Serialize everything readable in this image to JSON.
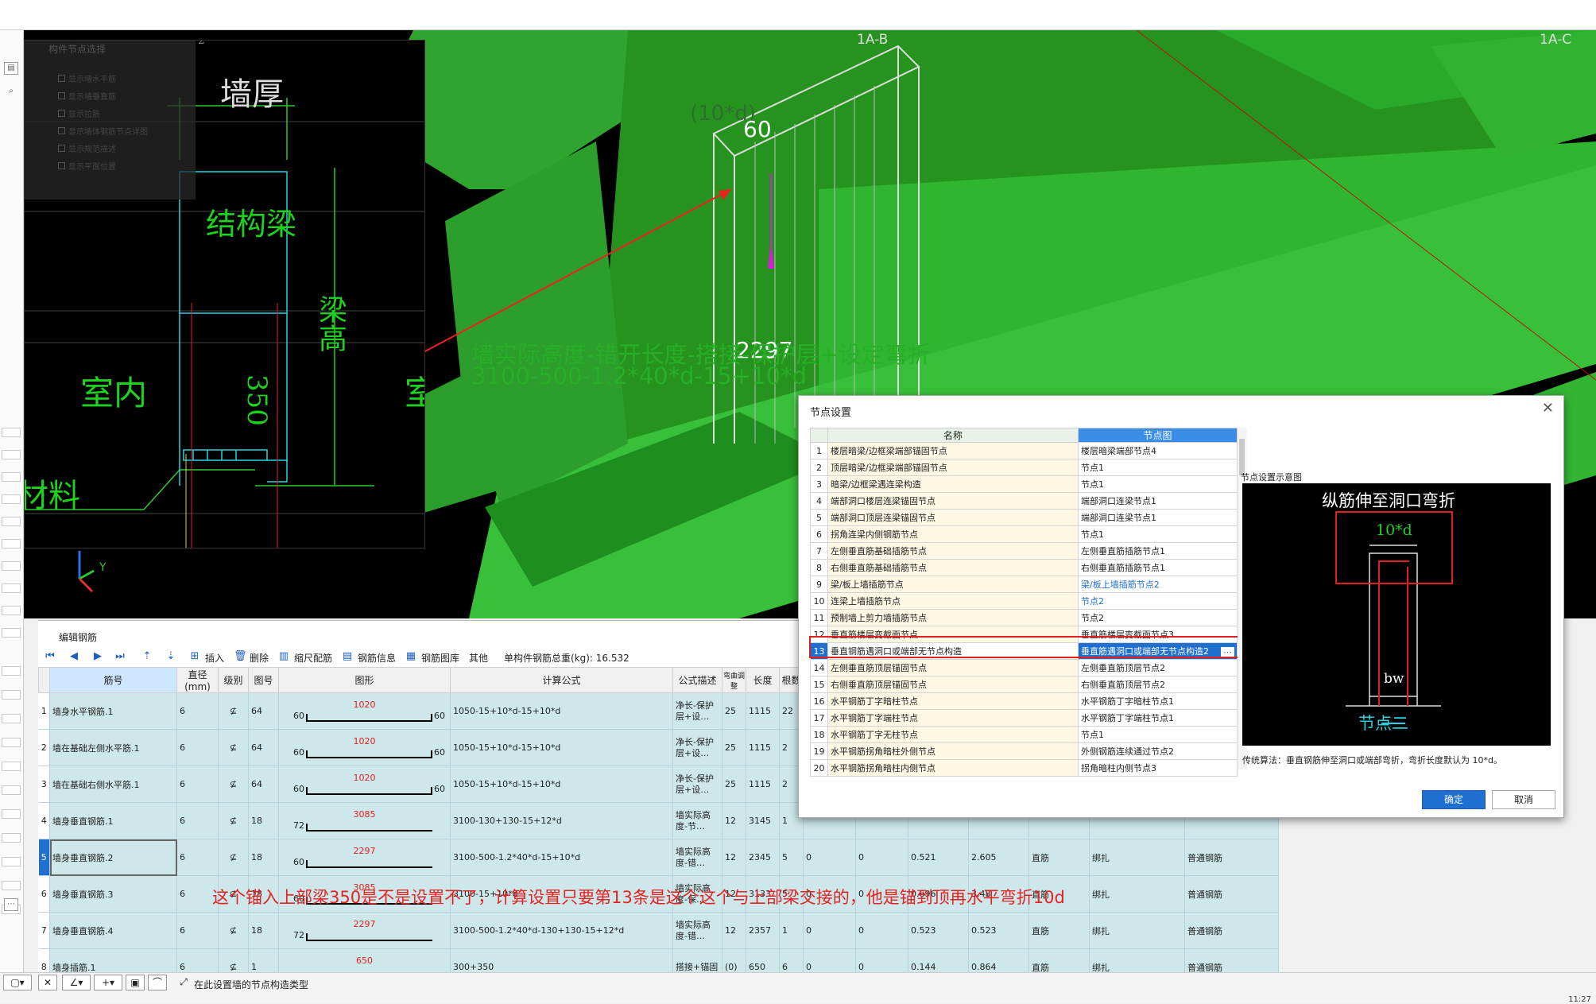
{
  "viewport": {
    "axis_labels": [
      "1A-B",
      "1A-C"
    ],
    "dim_60": "60",
    "dim_10d": "(10*d)",
    "dim_2297": "2297",
    "formula_line1": "墙实际高度-错开长度-搭接-保护层+设定弯折",
    "formula_line2": "3100-500-1.2*40*d-15+10*d",
    "ucs_y": "Y",
    "ucs_x": "X"
  },
  "inset": {
    "panel_title": "构件节点选择",
    "panel_items": [
      "显示墙水平筋",
      "显示墙垂直筋",
      "显示拉筋",
      "显示墙体钢筋节点详图",
      "显示规范描述",
      "显示平面位置"
    ],
    "labels": {
      "wall_thickness": "墙厚",
      "structural_beam": "结构梁",
      "beam_height": "梁高",
      "indoor": "室内",
      "indoor_right": "室",
      "dim_350": "350",
      "material": "材料",
      "tab_num": "2"
    }
  },
  "editor": {
    "title": "编辑钢筋",
    "toolbar": {
      "insert": "插入",
      "delete": "删除",
      "scale_rebar": "缩尺配筋",
      "rebar_info": "钢筋信息",
      "rebar_lib": "钢筋图库",
      "other": "其他",
      "total_weight": "单构件钢筋总重(kg): 16.532"
    },
    "headers": [
      "筋号",
      "直径(mm)",
      "级别",
      "图号",
      "图形",
      "计算公式",
      "公式描述",
      "弯曲调整",
      "长度",
      "根数"
    ],
    "rows": [
      {
        "no": "1",
        "name": "墙身水平钢筋.1",
        "dia": "6",
        "grade": "⊈",
        "fig": "64",
        "left": "60",
        "val": "1020",
        "right": "60",
        "formula": "1050-15+10*d-15+10*d",
        "desc": "净长-保护层+设…",
        "bend": "25",
        "len": "1115",
        "cnt": "22",
        "a": "",
        "b": "",
        "c": "",
        "d": "",
        "e": "",
        "f": "",
        "g": ""
      },
      {
        "no": "2",
        "name": "墙在基础左侧水平筋.1",
        "dia": "6",
        "grade": "⊈",
        "fig": "64",
        "left": "60",
        "val": "1020",
        "right": "60",
        "formula": "1050-15+10*d-15+10*d",
        "desc": "净长-保护层+设…",
        "bend": "25",
        "len": "1115",
        "cnt": "2",
        "a": "",
        "b": "",
        "c": "",
        "d": "",
        "e": "",
        "f": "",
        "g": ""
      },
      {
        "no": "3",
        "name": "墙在基础右侧水平筋.1",
        "dia": "6",
        "grade": "⊈",
        "fig": "64",
        "left": "60",
        "val": "1020",
        "right": "60",
        "formula": "1050-15+10*d-15+10*d",
        "desc": "净长-保护层+设…",
        "bend": "25",
        "len": "1115",
        "cnt": "2",
        "a": "",
        "b": "",
        "c": "",
        "d": "",
        "e": "",
        "f": "",
        "g": ""
      },
      {
        "no": "4",
        "name": "墙身垂直钢筋.1",
        "dia": "6",
        "grade": "⊈",
        "fig": "18",
        "left": "72",
        "val": "3085",
        "right": "",
        "formula": "3100-130+130-15+12*d",
        "desc": "墙实际高度-节…",
        "bend": "12",
        "len": "3145",
        "cnt": "1",
        "a": "",
        "b": "",
        "c": "",
        "d": "",
        "e": "",
        "f": "",
        "g": ""
      },
      {
        "no": "5",
        "name": "墙身垂直钢筋.2",
        "dia": "6",
        "grade": "⊈",
        "fig": "18",
        "left": "60",
        "val": "2297",
        "right": "",
        "formula": "3100-500-1.2*40*d-15+10*d",
        "desc": "墙实际高度-错…",
        "bend": "12",
        "len": "2345",
        "cnt": "5",
        "a": "0",
        "b": "0",
        "c": "0.521",
        "d": "2.605",
        "e": "直筋",
        "f": "绑扎",
        "g": "普通钢筋"
      },
      {
        "no": "6",
        "name": "墙身垂直钢筋.3",
        "dia": "6",
        "grade": "⊈",
        "fig": "18",
        "left": "60",
        "val": "3085",
        "right": "",
        "formula": "3100-15+10*d",
        "desc": "墙实际高度-保…",
        "bend": "12",
        "len": "3133",
        "cnt": "5",
        "a": "0",
        "b": "0",
        "c": "0.696",
        "d": "3.48",
        "e": "直筋",
        "f": "绑扎",
        "g": "普通钢筋"
      },
      {
        "no": "7",
        "name": "墙身垂直钢筋.4",
        "dia": "6",
        "grade": "⊈",
        "fig": "18",
        "left": "72",
        "val": "2297",
        "right": "",
        "formula": "3100-500-1.2*40*d-130+130-15+12*d",
        "desc": "墙实际高度-错…",
        "bend": "12",
        "len": "2357",
        "cnt": "1",
        "a": "0",
        "b": "0",
        "c": "0.523",
        "d": "0.523",
        "e": "直筋",
        "f": "绑扎",
        "g": "普通钢筋"
      },
      {
        "no": "8",
        "name": "墙身插筋.1",
        "dia": "6",
        "grade": "⊈",
        "fig": "1",
        "left": "",
        "val": "650",
        "right": "",
        "formula": "300+350",
        "desc": "搭接+锚固",
        "bend": "(0)",
        "len": "650",
        "cnt": "6",
        "a": "0",
        "b": "0",
        "c": "0.144",
        "d": "0.864",
        "e": "直筋",
        "f": "绑扎",
        "g": "普通钢筋"
      }
    ],
    "note": "这个锚入上部梁350是不是设置不了，计算设置只要第13条是这个这个与上部梁交接的，他是锚到顶再水平弯折10d"
  },
  "dialog": {
    "title": "节点设置",
    "close": "✕",
    "col_name": "名称",
    "col_node": "节点图",
    "rows": [
      {
        "n": "1",
        "name": "楼层暗梁/边框梁端部锚固节点",
        "node": "楼层暗梁端部节点4"
      },
      {
        "n": "2",
        "name": "顶层暗梁/边框梁端部锚固节点",
        "node": "节点1"
      },
      {
        "n": "3",
        "name": "暗梁/边框梁遇连梁构造",
        "node": "节点1"
      },
      {
        "n": "4",
        "name": "端部洞口楼层连梁锚固节点",
        "node": "端部洞口连梁节点1"
      },
      {
        "n": "5",
        "name": "端部洞口顶层连梁锚固节点",
        "node": "端部洞口连梁节点1"
      },
      {
        "n": "6",
        "name": "拐角连梁内侧钢筋节点",
        "node": "节点1"
      },
      {
        "n": "7",
        "name": "左侧垂直筋基础插筋节点",
        "node": "左侧垂直筋插筋节点1"
      },
      {
        "n": "8",
        "name": "右侧垂直筋基础插筋节点",
        "node": "右侧垂直筋插筋节点1"
      },
      {
        "n": "9",
        "name": "梁/板上墙插筋节点",
        "node": "梁/板上墙插筋节点2",
        "blue": true
      },
      {
        "n": "10",
        "name": "连梁上墙插筋节点",
        "node": "节点2",
        "blue": true
      },
      {
        "n": "11",
        "name": "预制墙上剪力墙插筋节点",
        "node": "节点2"
      },
      {
        "n": "12",
        "name": "垂直筋楼层变截面节点",
        "node": "垂直筋楼层变截面节点3"
      },
      {
        "n": "13",
        "name": "垂直钢筋遇洞口或端部无节点构造",
        "node": "垂直筋遇洞口或端部无节点构造2",
        "sel": true
      },
      {
        "n": "14",
        "name": "左侧垂直筋顶层锚固节点",
        "node": "左侧垂直筋顶层节点2"
      },
      {
        "n": "15",
        "name": "右侧垂直筋顶层锚固节点",
        "node": "右侧垂直筋顶层节点2"
      },
      {
        "n": "16",
        "name": "水平钢筋丁字暗柱节点",
        "node": "水平钢筋丁字暗柱节点1"
      },
      {
        "n": "17",
        "name": "水平钢筋丁字端柱节点",
        "node": "水平钢筋丁字端柱节点1"
      },
      {
        "n": "18",
        "name": "水平钢筋丁字无柱节点",
        "node": "节点1"
      },
      {
        "n": "19",
        "name": "水平钢筋拐角暗柱外侧节点",
        "node": "外侧钢筋连续通过节点2"
      },
      {
        "n": "20",
        "name": "水平钢筋拐角暗柱内侧节点",
        "node": "拐角暗柱内侧节点3"
      }
    ],
    "preview_title": "节点设置示意图",
    "preview_heading": "纵筋伸至洞口弯折",
    "preview_10d": "10*d",
    "preview_bw": "bw",
    "preview_node": "节点二",
    "preview_note": "传统算法：垂直钢筋伸至洞口或端部弯折，弯折长度默认为 10*d。",
    "ok": "确定",
    "cancel": "取消"
  },
  "status": {
    "text": "在此设置墙的节点构造类型",
    "clock": "11:27"
  }
}
